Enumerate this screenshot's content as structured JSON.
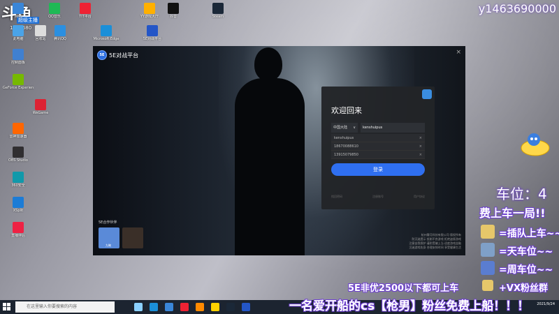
{
  "stream": {
    "logo_text": "斗鱼",
    "logo_tag": "超级主播",
    "room_id": "1068680",
    "watermark": "y1463690000"
  },
  "desktop_icons": [
    {
      "label": "网络",
      "color": "#3a86d8"
    },
    {
      "label": "QQ音乐",
      "color": "#1fb955"
    },
    {
      "label": "TIT平台",
      "color": "#e23"
    },
    {
      "label": "YY游戏大厅",
      "color": "#ffb000"
    },
    {
      "label": "抖音",
      "color": "#111"
    },
    {
      "label": "Steam",
      "color": "#1b2838"
    },
    {
      "label": "此电脑",
      "color": "#4aa3e8"
    },
    {
      "label": "回收站",
      "color": "#ddd"
    },
    {
      "label": "Microsoft Edge",
      "color": "#1b8fd8"
    },
    {
      "label": "腾讯QQ",
      "color": "#2b8fe0"
    },
    {
      "label": "5E对战平台",
      "color": "#2456c7"
    },
    {
      "label": "控制面板",
      "color": "#4080d0"
    },
    {
      "label": "GeForce Experience",
      "color": "#76b900"
    },
    {
      "label": "WeGame",
      "color": "#d23"
    },
    {
      "label": "雷神加速器",
      "color": "#f60"
    },
    {
      "label": "OBS Studio",
      "color": "#302e31"
    },
    {
      "label": "XSplit",
      "color": "#1c7cd6"
    },
    {
      "label": "360安全",
      "color": "#19a"
    },
    {
      "label": "直播伴侣",
      "color": "#e24"
    }
  ],
  "app": {
    "brand": "5E对战平台",
    "brand_badge": "5E",
    "close": "×",
    "login": {
      "title": "欢迎回来",
      "region": "中国大陆",
      "username": "kenshuipus",
      "history": [
        "kenshuipus",
        "18670088610",
        "13915079850"
      ],
      "login_button": "登录",
      "links": [
        "找回密码",
        "注册账号",
        "用户协议"
      ]
    },
    "partners_title": "5E合作伙伴",
    "partners": [
      {
        "name": "九畹",
        "color": "#5a8ad8"
      },
      {
        "name": "",
        "color": "#3a2f28"
      }
    ],
    "legal": "杭州雾月科技有限公司 版权所有\n防沉迷提示 抵制不良游戏 拒绝盗版游戏\n注意自我保护 谨防受骗上当 适度游戏益脑\n沉迷游戏伤身 合理安排时间 享受健康生活"
  },
  "overlay": {
    "car_seat": "车位：4",
    "slogan_top": "费上车一局!!",
    "rules": [
      {
        "text": "=插队上车~~",
        "color": "#e6c76a"
      },
      {
        "text": "=天车位~~",
        "color": "#7fa0c8"
      },
      {
        "text": "=周车位~~",
        "color": "#5a7dd0"
      }
    ],
    "line1_a": "5E非优2500以下都可上车",
    "line1_b": "+VX粉丝群",
    "line2": "一名爱开船的cs【枪男】粉丝免费上船！！！"
  },
  "taskbar": {
    "search_placeholder": "在这里输入你要搜索的内容",
    "clock_time": "",
    "clock_date": "2021/9/24",
    "apps": [
      "#8bd0ff",
      "#1b8fd8",
      "#3a86d8",
      "#e23",
      "#ff8a00",
      "#ffd200",
      "#1b2838",
      "#2456c7"
    ]
  }
}
